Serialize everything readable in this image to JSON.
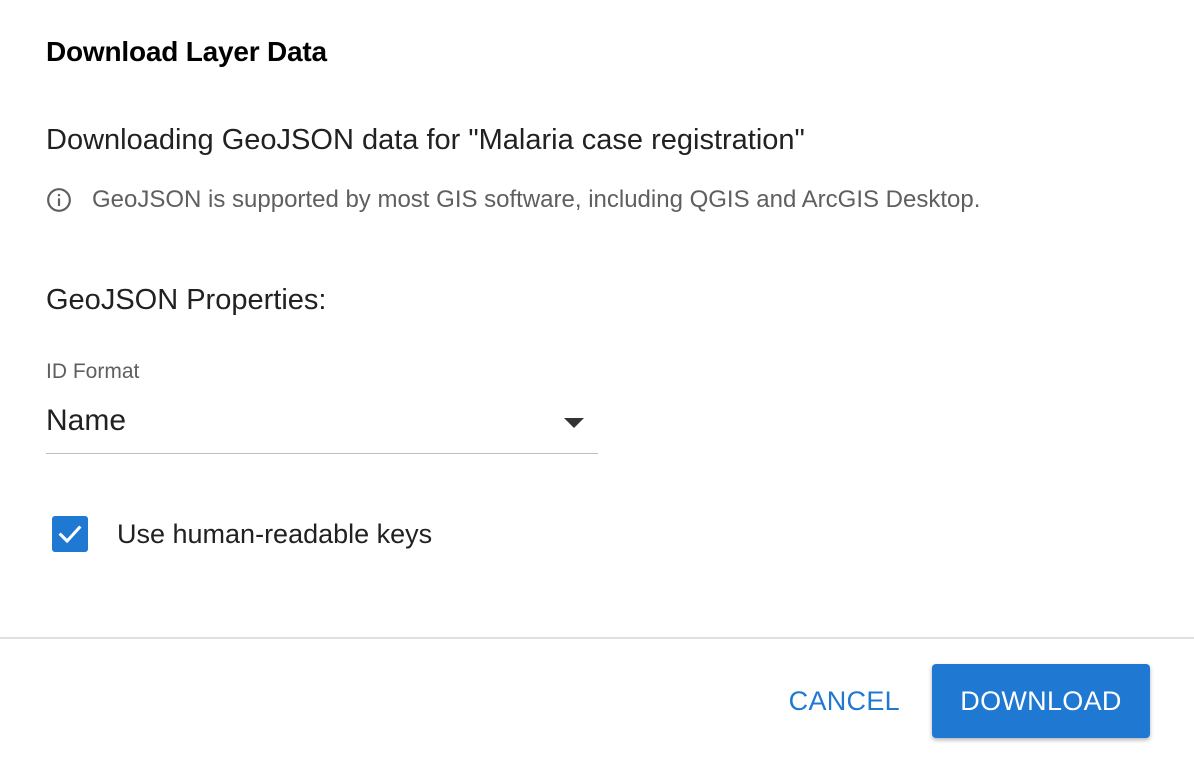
{
  "dialog": {
    "title": "Download Layer Data",
    "download_heading": "Downloading GeoJSON data for \"Malaria case registration\"",
    "info_text": "GeoJSON is supported by most GIS software, including QGIS and ArcGIS Desktop.",
    "info_icon": "info-circle-icon",
    "properties_heading": "GeoJSON Properties:"
  },
  "id_format": {
    "label": "ID Format",
    "value": "Name"
  },
  "human_readable": {
    "label": "Use human-readable keys",
    "checked": true
  },
  "actions": {
    "cancel_label": "CANCEL",
    "download_label": "DOWNLOAD"
  },
  "colors": {
    "primary": "#1f78d2",
    "text": "#212121",
    "secondary_text": "#5f5f5f",
    "divider": "#e0e0e0"
  }
}
